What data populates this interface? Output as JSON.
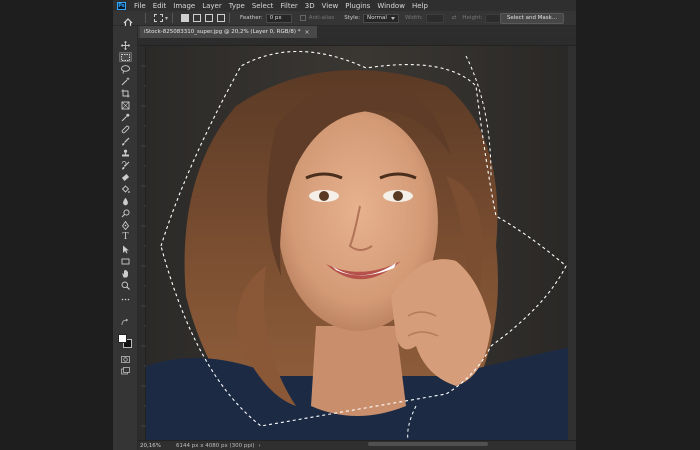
{
  "app": {
    "logo": "Ps",
    "accent": "#31a8ff"
  },
  "menu": [
    "File",
    "Edit",
    "Image",
    "Layer",
    "Type",
    "Select",
    "Filter",
    "3D",
    "View",
    "Plugins",
    "Window",
    "Help"
  ],
  "options": {
    "feather_label": "Feather:",
    "feather_value": "0 px",
    "antialias_label": "Anti-alias",
    "style_label": "Style:",
    "style_value": "Normal",
    "width_label": "Width:",
    "height_label": "Height:",
    "select_mask_label": "Select and Mask..."
  },
  "document": {
    "tab_title": "iStock-825083310_super.jpg @ 20,2% (Layer 0, RGB/8) *",
    "close_glyph": "×"
  },
  "status": {
    "zoom": "20,16%",
    "info": "6144 px x 4080 px (300 ppi)",
    "chevron": "›"
  },
  "tools": [
    {
      "name": "move-tool",
      "icon": "move-icon"
    },
    {
      "name": "marquee-tool",
      "icon": "rect-marquee-icon",
      "active": true
    },
    {
      "name": "lasso-tool",
      "icon": "lasso-icon"
    },
    {
      "name": "quick-select-tool",
      "icon": "magic-wand-icon"
    },
    {
      "name": "crop-tool",
      "icon": "crop-icon"
    },
    {
      "name": "frame-tool",
      "icon": "frame-icon"
    },
    {
      "name": "eyedropper-tool",
      "icon": "eyedropper-icon"
    },
    {
      "name": "healing-tool",
      "icon": "bandage-icon"
    },
    {
      "name": "brush-tool",
      "icon": "brush-icon"
    },
    {
      "name": "stamp-tool",
      "icon": "stamp-icon"
    },
    {
      "name": "history-brush-tool",
      "icon": "history-brush-icon"
    },
    {
      "name": "eraser-tool",
      "icon": "eraser-icon"
    },
    {
      "name": "gradient-tool",
      "icon": "bucket-icon"
    },
    {
      "name": "blur-tool",
      "icon": "drop-icon"
    },
    {
      "name": "dodge-tool",
      "icon": "dodge-icon"
    },
    {
      "name": "pen-tool",
      "icon": "pen-icon"
    },
    {
      "name": "type-tool",
      "icon": "type-icon"
    },
    {
      "name": "path-select-tool",
      "icon": "arrow-icon"
    },
    {
      "name": "shape-tool",
      "icon": "rectangle-icon"
    },
    {
      "name": "hand-tool",
      "icon": "hand-icon"
    },
    {
      "name": "zoom-tool",
      "icon": "zoom-icon"
    },
    {
      "name": "more-tools",
      "icon": "ellipsis-icon"
    }
  ],
  "type_glyph": "T"
}
